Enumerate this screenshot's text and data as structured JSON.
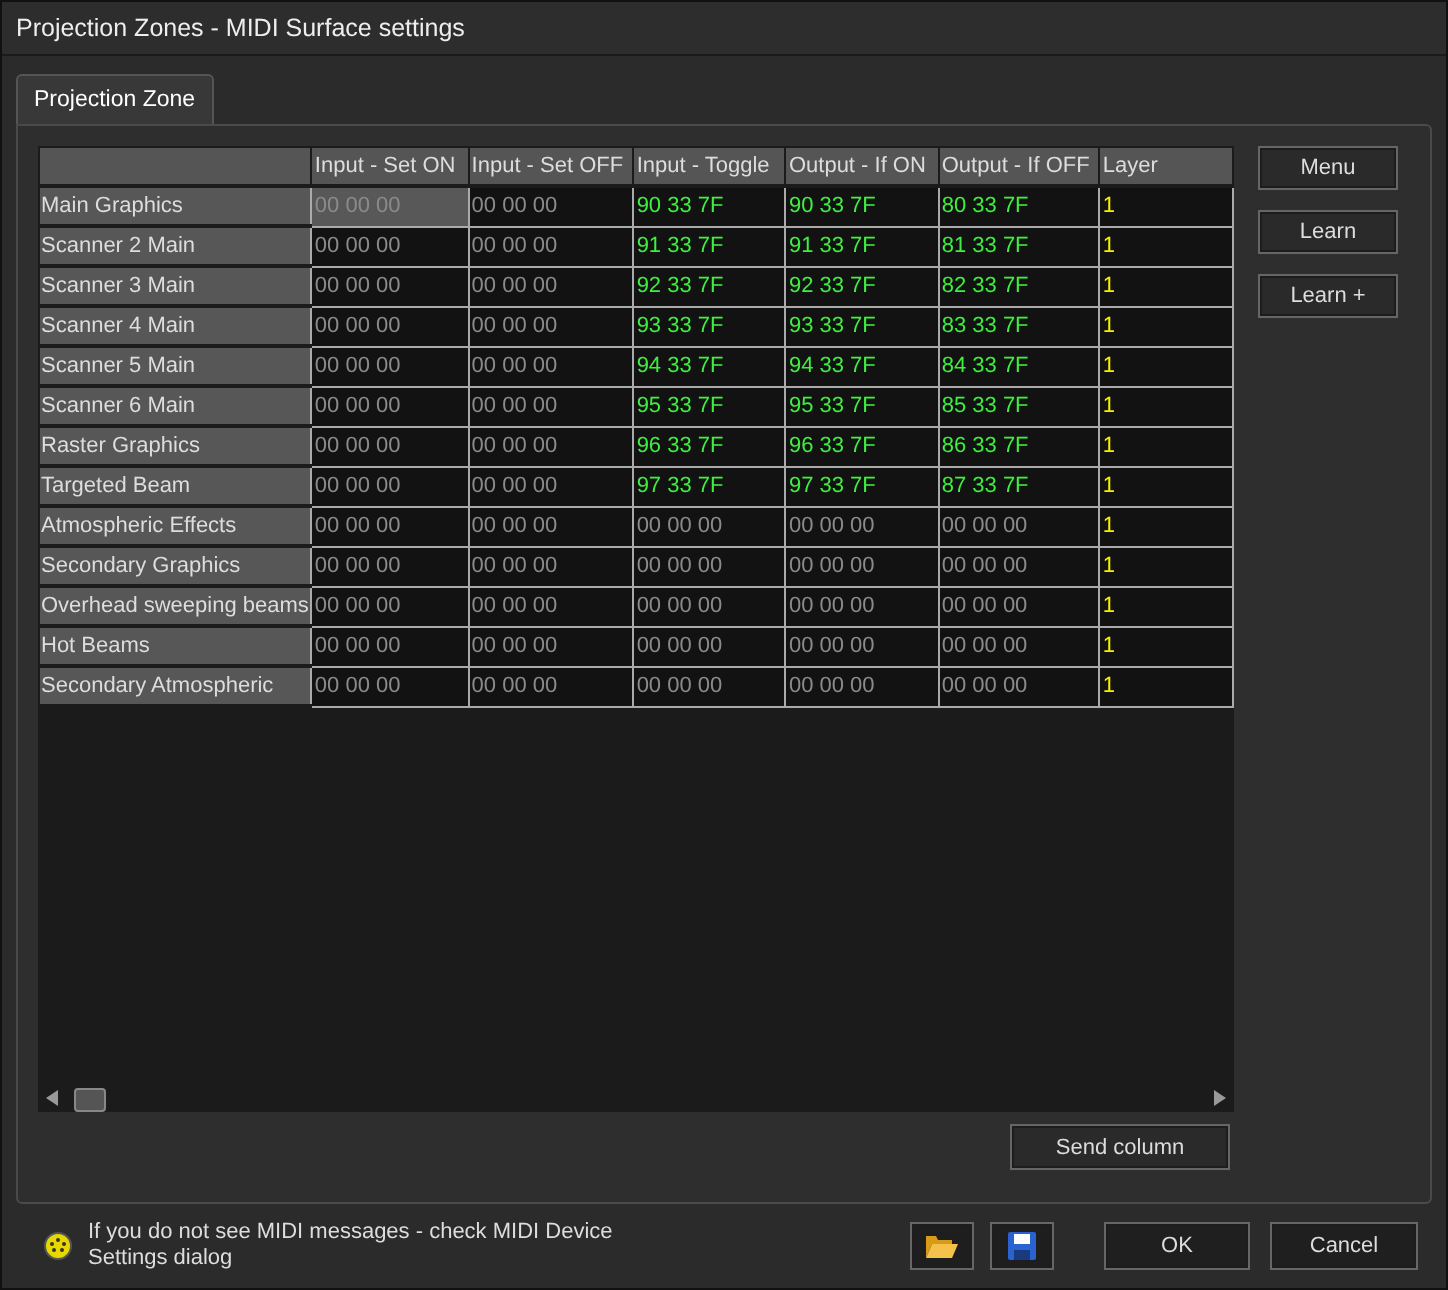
{
  "window": {
    "title": "Projection Zones - MIDI Surface settings"
  },
  "tabs": [
    {
      "label": "Projection Zone",
      "selected": true
    }
  ],
  "table": {
    "columns": [
      "Input - Set ON",
      "Input - Set OFF",
      "Input - Toggle",
      "Output - If ON",
      "Output - If OFF",
      "Layer"
    ],
    "rows": [
      {
        "name": "Main Graphics",
        "cells": [
          {
            "text": "00 00 00",
            "kind": "empty",
            "selected": true
          },
          {
            "text": "00 00 00",
            "kind": "empty",
            "selected": false
          },
          {
            "text": "90 33 7F",
            "kind": "midi",
            "selected": false
          },
          {
            "text": "90 33 7F",
            "kind": "midi",
            "selected": false
          },
          {
            "text": "80 33 7F",
            "kind": "midi",
            "selected": false
          },
          {
            "text": "1",
            "kind": "layer",
            "selected": false
          }
        ]
      },
      {
        "name": "Scanner 2 Main",
        "cells": [
          {
            "text": "00 00 00",
            "kind": "empty",
            "selected": false
          },
          {
            "text": "00 00 00",
            "kind": "empty",
            "selected": false
          },
          {
            "text": "91 33 7F",
            "kind": "midi",
            "selected": false
          },
          {
            "text": "91 33 7F",
            "kind": "midi",
            "selected": false
          },
          {
            "text": "81 33 7F",
            "kind": "midi",
            "selected": false
          },
          {
            "text": "1",
            "kind": "layer",
            "selected": false
          }
        ]
      },
      {
        "name": "Scanner 3 Main",
        "cells": [
          {
            "text": "00 00 00",
            "kind": "empty",
            "selected": false
          },
          {
            "text": "00 00 00",
            "kind": "empty",
            "selected": false
          },
          {
            "text": "92 33 7F",
            "kind": "midi",
            "selected": false
          },
          {
            "text": "92 33 7F",
            "kind": "midi",
            "selected": false
          },
          {
            "text": "82 33 7F",
            "kind": "midi",
            "selected": false
          },
          {
            "text": "1",
            "kind": "layer",
            "selected": false
          }
        ]
      },
      {
        "name": "Scanner 4 Main",
        "cells": [
          {
            "text": "00 00 00",
            "kind": "empty",
            "selected": false
          },
          {
            "text": "00 00 00",
            "kind": "empty",
            "selected": false
          },
          {
            "text": "93 33 7F",
            "kind": "midi",
            "selected": false
          },
          {
            "text": "93 33 7F",
            "kind": "midi",
            "selected": false
          },
          {
            "text": "83 33 7F",
            "kind": "midi",
            "selected": false
          },
          {
            "text": "1",
            "kind": "layer",
            "selected": false
          }
        ]
      },
      {
        "name": "Scanner 5 Main",
        "cells": [
          {
            "text": "00 00 00",
            "kind": "empty",
            "selected": false
          },
          {
            "text": "00 00 00",
            "kind": "empty",
            "selected": false
          },
          {
            "text": "94 33 7F",
            "kind": "midi",
            "selected": false
          },
          {
            "text": "94 33 7F",
            "kind": "midi",
            "selected": false
          },
          {
            "text": "84 33 7F",
            "kind": "midi",
            "selected": false
          },
          {
            "text": "1",
            "kind": "layer",
            "selected": false
          }
        ]
      },
      {
        "name": "Scanner 6 Main",
        "cells": [
          {
            "text": "00 00 00",
            "kind": "empty",
            "selected": false
          },
          {
            "text": "00 00 00",
            "kind": "empty",
            "selected": false
          },
          {
            "text": "95 33 7F",
            "kind": "midi",
            "selected": false
          },
          {
            "text": "95 33 7F",
            "kind": "midi",
            "selected": false
          },
          {
            "text": "85 33 7F",
            "kind": "midi",
            "selected": false
          },
          {
            "text": "1",
            "kind": "layer",
            "selected": false
          }
        ]
      },
      {
        "name": "Raster Graphics",
        "cells": [
          {
            "text": "00 00 00",
            "kind": "empty",
            "selected": false
          },
          {
            "text": "00 00 00",
            "kind": "empty",
            "selected": false
          },
          {
            "text": "96 33 7F",
            "kind": "midi",
            "selected": false
          },
          {
            "text": "96 33 7F",
            "kind": "midi",
            "selected": false
          },
          {
            "text": "86 33 7F",
            "kind": "midi",
            "selected": false
          },
          {
            "text": "1",
            "kind": "layer",
            "selected": false
          }
        ]
      },
      {
        "name": "Targeted Beam",
        "cells": [
          {
            "text": "00 00 00",
            "kind": "empty",
            "selected": false
          },
          {
            "text": "00 00 00",
            "kind": "empty",
            "selected": false
          },
          {
            "text": "97 33 7F",
            "kind": "midi",
            "selected": false
          },
          {
            "text": "97 33 7F",
            "kind": "midi",
            "selected": false
          },
          {
            "text": "87 33 7F",
            "kind": "midi",
            "selected": false
          },
          {
            "text": "1",
            "kind": "layer",
            "selected": false
          }
        ]
      },
      {
        "name": "Atmospheric Effects",
        "cells": [
          {
            "text": "00 00 00",
            "kind": "empty",
            "selected": false
          },
          {
            "text": "00 00 00",
            "kind": "empty",
            "selected": false
          },
          {
            "text": "00 00 00",
            "kind": "empty",
            "selected": false
          },
          {
            "text": "00 00 00",
            "kind": "empty",
            "selected": false
          },
          {
            "text": "00 00 00",
            "kind": "empty",
            "selected": false
          },
          {
            "text": "1",
            "kind": "layer",
            "selected": false
          }
        ]
      },
      {
        "name": "Secondary Graphics",
        "cells": [
          {
            "text": "00 00 00",
            "kind": "empty",
            "selected": false
          },
          {
            "text": "00 00 00",
            "kind": "empty",
            "selected": false
          },
          {
            "text": "00 00 00",
            "kind": "empty",
            "selected": false
          },
          {
            "text": "00 00 00",
            "kind": "empty",
            "selected": false
          },
          {
            "text": "00 00 00",
            "kind": "empty",
            "selected": false
          },
          {
            "text": "1",
            "kind": "layer",
            "selected": false
          }
        ]
      },
      {
        "name": "Overhead sweeping beams",
        "cells": [
          {
            "text": "00 00 00",
            "kind": "empty",
            "selected": false
          },
          {
            "text": "00 00 00",
            "kind": "empty",
            "selected": false
          },
          {
            "text": "00 00 00",
            "kind": "empty",
            "selected": false
          },
          {
            "text": "00 00 00",
            "kind": "empty",
            "selected": false
          },
          {
            "text": "00 00 00",
            "kind": "empty",
            "selected": false
          },
          {
            "text": "1",
            "kind": "layer",
            "selected": false
          }
        ]
      },
      {
        "name": "Hot Beams",
        "cells": [
          {
            "text": "00 00 00",
            "kind": "empty",
            "selected": false
          },
          {
            "text": "00 00 00",
            "kind": "empty",
            "selected": false
          },
          {
            "text": "00 00 00",
            "kind": "empty",
            "selected": false
          },
          {
            "text": "00 00 00",
            "kind": "empty",
            "selected": false
          },
          {
            "text": "00 00 00",
            "kind": "empty",
            "selected": false
          },
          {
            "text": "1",
            "kind": "layer",
            "selected": false
          }
        ]
      },
      {
        "name": "Secondary Atmospheric",
        "cells": [
          {
            "text": "00 00 00",
            "kind": "empty",
            "selected": false
          },
          {
            "text": "00 00 00",
            "kind": "empty",
            "selected": false
          },
          {
            "text": "00 00 00",
            "kind": "empty",
            "selected": false
          },
          {
            "text": "00 00 00",
            "kind": "empty",
            "selected": false
          },
          {
            "text": "00 00 00",
            "kind": "empty",
            "selected": false
          },
          {
            "text": "1",
            "kind": "layer",
            "selected": false
          }
        ]
      }
    ]
  },
  "side_buttons": [
    "Menu",
    "Learn",
    "Learn +"
  ],
  "send_button": "Send column",
  "status_message": "If you do not see MIDI messages - check MIDI Device Settings dialog",
  "buttons": [
    "OK",
    "Cancel"
  ]
}
